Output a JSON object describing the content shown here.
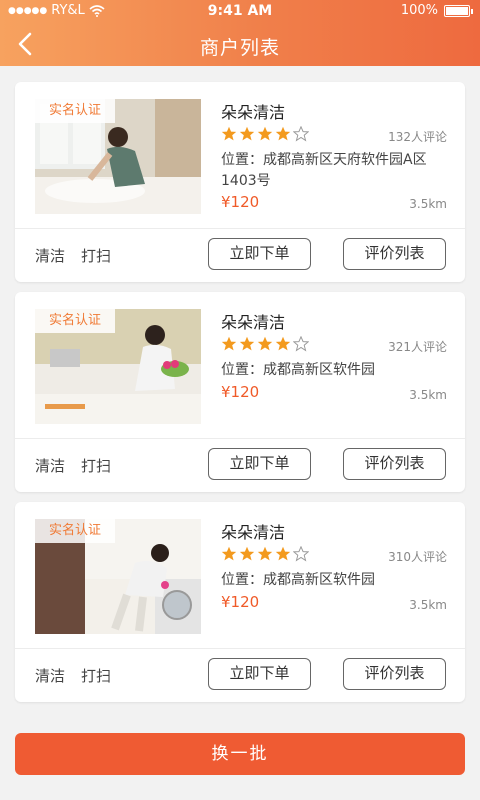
{
  "status_bar": {
    "carrier": "RY&L",
    "time": "9:41 AM",
    "battery": "100%"
  },
  "header": {
    "title": "商户列表",
    "back_icon": "chevron-left-icon"
  },
  "colors": {
    "accent": "#f07f4a",
    "price": "#f05a28",
    "star": "#f39a1e",
    "button_bottom": "#ef5b33"
  },
  "merchants": [
    {
      "badge": "实名认证",
      "name": "朵朵清洁",
      "rating": 4,
      "reviews": "132人评论",
      "address": "位置：成都高新区天府软件园A区1403号",
      "price": "¥120",
      "distance": "3.5km",
      "tags": [
        "清洁",
        "打扫"
      ],
      "order_label": "立即下单",
      "review_label": "评价列表"
    },
    {
      "badge": "实名认证",
      "name": "朵朵清洁",
      "rating": 4,
      "reviews": "321人评论",
      "address": "位置：成都高新区软件园",
      "price": "¥120",
      "distance": "3.5km",
      "tags": [
        "清洁",
        "打扫"
      ],
      "order_label": "立即下单",
      "review_label": "评价列表"
    },
    {
      "badge": "实名认证",
      "name": "朵朵清洁",
      "rating": 4,
      "reviews": "310人评论",
      "address": "位置：成都高新区软件园",
      "price": "¥120",
      "distance": "3.5km",
      "tags": [
        "清洁",
        "打扫"
      ],
      "order_label": "立即下单",
      "review_label": "评价列表"
    }
  ],
  "bottom_button": "换一批"
}
